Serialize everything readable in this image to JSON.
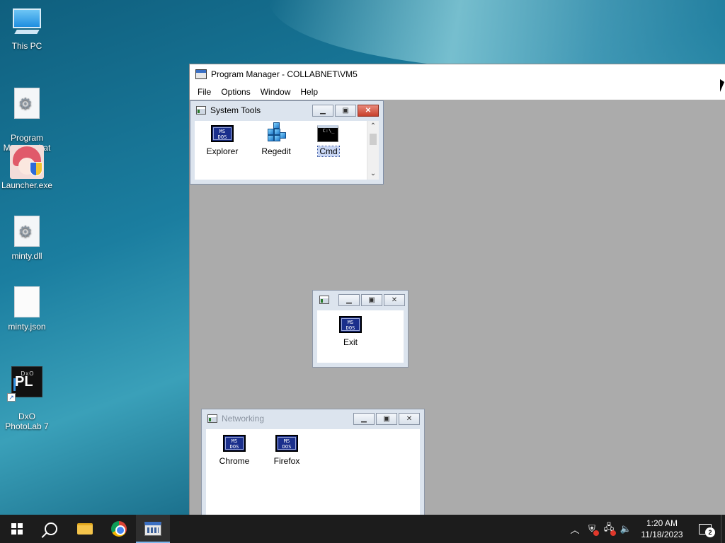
{
  "desktop": {
    "icons": [
      {
        "label": "This PC",
        "icon": "this-pc-icon"
      },
      {
        "label": "Program\nManager.bat",
        "icon": "batch-file-icon"
      },
      {
        "label": "Launcher.exe",
        "icon": "launcher-app-icon"
      },
      {
        "label": "minty.dll",
        "icon": "dll-file-icon"
      },
      {
        "label": "minty.json",
        "icon": "json-file-icon"
      },
      {
        "label": "DxO\nPhotoLab 7",
        "icon": "dxo-photolab-icon"
      }
    ],
    "dxo_badge_top": "DxO",
    "dxo_badge_main": "PL"
  },
  "program_manager": {
    "title": "Program Manager - COLLABNET\\VM5",
    "menu": [
      "File",
      "Options",
      "Window",
      "Help"
    ],
    "groups": {
      "system_tools": {
        "title": "System Tools",
        "items": [
          {
            "label": "Explorer",
            "icon": "ms-dos-icon"
          },
          {
            "label": "Regedit",
            "icon": "regedit-icon"
          },
          {
            "label": "Cmd",
            "icon": "cmd-icon"
          }
        ]
      },
      "untitled": {
        "title": "",
        "items": [
          {
            "label": "Exit",
            "icon": "ms-dos-icon"
          }
        ]
      },
      "networking": {
        "title": "Networking",
        "items": [
          {
            "label": "Chrome",
            "icon": "ms-dos-icon"
          },
          {
            "label": "Firefox",
            "icon": "ms-dos-icon"
          }
        ]
      }
    },
    "msdos_text_line1": "MS",
    "msdos_text_line2": "DOS"
  },
  "taskbar": {
    "apps": [
      "start",
      "search",
      "file-explorer",
      "chrome",
      "program-manager"
    ],
    "clock_time": "1:20 AM",
    "clock_date": "11/18/2023",
    "notification_count": "2"
  },
  "colors": {
    "taskbar": "#1c1c1c",
    "workspace": "#ababab",
    "accent": "#7fb8ee"
  }
}
